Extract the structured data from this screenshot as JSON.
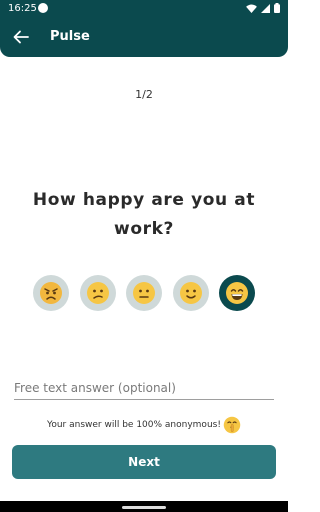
{
  "status_bar": {
    "time": "16:25"
  },
  "app_bar": {
    "title": "Pulse"
  },
  "survey": {
    "progress": "1/2",
    "question": "How happy are you at work?",
    "ratings": [
      {
        "mood": "angry",
        "selected": false
      },
      {
        "mood": "confused",
        "selected": false
      },
      {
        "mood": "neutral",
        "selected": false
      },
      {
        "mood": "slightly-smiling",
        "selected": false
      },
      {
        "mood": "grinning",
        "selected": true
      }
    ],
    "free_text_placeholder": "Free text answer (optional)",
    "free_text_value": "",
    "anonymous_note": "Your answer will be 100% anonymous!",
    "next_label": "Next"
  },
  "colors": {
    "primary_dark": "#0b4a4e",
    "button": "#2e7a80",
    "rating_bg": "#cfd9d9",
    "emoji_yellow": "#f6c644"
  }
}
